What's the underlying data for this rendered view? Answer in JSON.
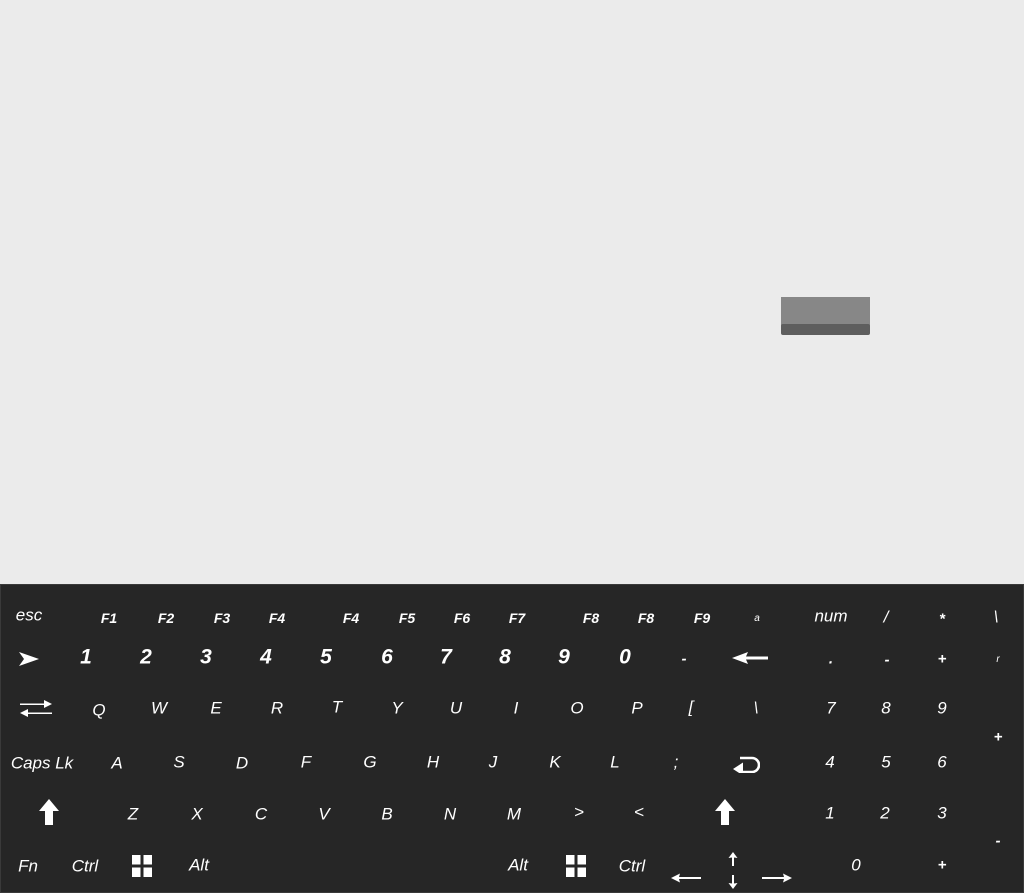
{
  "keyboard": {
    "row_fn": {
      "esc": "esc",
      "f1": "F1",
      "f2": "F2",
      "f3": "F3",
      "f4": "F4",
      "f4b": "F4",
      "f5": "F5",
      "f6": "F6",
      "f7": "F7",
      "f8": "F8",
      "f8b": "F8",
      "f9": "F9",
      "small": "a",
      "num": "num",
      "slash": "/",
      "star": "*",
      "backslash": "\\"
    },
    "row_num": {
      "k1": "1",
      "k2": "2",
      "k3": "3",
      "k4": "4",
      "k5": "5",
      "k6": "6",
      "k7": "7",
      "k8": "8",
      "k9": "9",
      "k0": "0",
      "minus": "-",
      "np_dot": ".",
      "np_minus": "-",
      "np_plus": "+",
      "np_small": "r"
    },
    "row_q": {
      "q": "Q",
      "w": "W",
      "e": "E",
      "r": "R",
      "t": "T",
      "y": "Y",
      "u": "U",
      "i": "I",
      "o": "O",
      "p": "P",
      "lbracket": "[",
      "backslash": "\\",
      "np7": "7",
      "np8": "8",
      "np9": "9"
    },
    "row_a": {
      "caps": "Caps Lk",
      "a": "A",
      "s": "S",
      "d": "D",
      "f": "F",
      "g": "G",
      "h": "H",
      "j": "J",
      "k": "K",
      "l": "L",
      "semicolon": ";",
      "np4": "4",
      "np5": "5",
      "np6": "6",
      "np_plus": "+"
    },
    "row_z": {
      "z": "Z",
      "x": "X",
      "c": "C",
      "v": "V",
      "b": "B",
      "n": "N",
      "m": "M",
      "gt": ">",
      "lt": "<",
      "np1": "1",
      "np2": "2",
      "np3": "3",
      "np_minus": "-"
    },
    "row_bottom": {
      "fn": "Fn",
      "ctrl_left": "Ctrl",
      "alt_left": "Alt",
      "alt_right": "Alt",
      "ctrl_right": "Ctrl",
      "np0": "0",
      "np_plus": "+"
    }
  },
  "colors": {
    "canvas": "#ebebeb",
    "keyboard_bg": "#262626",
    "key_text": "#ffffff",
    "widget_face": "#878787",
    "widget_base": "#5e5e5e"
  },
  "icons": {
    "tab": "tab-arrows-icon",
    "play": "play-arrow-icon",
    "backspace": "backspace-arrow-icon",
    "enter": "enter-return-icon",
    "shift": "shift-up-arrow-icon",
    "windows": "windows-logo-icon",
    "arrows": "arrow-keys-icon"
  }
}
